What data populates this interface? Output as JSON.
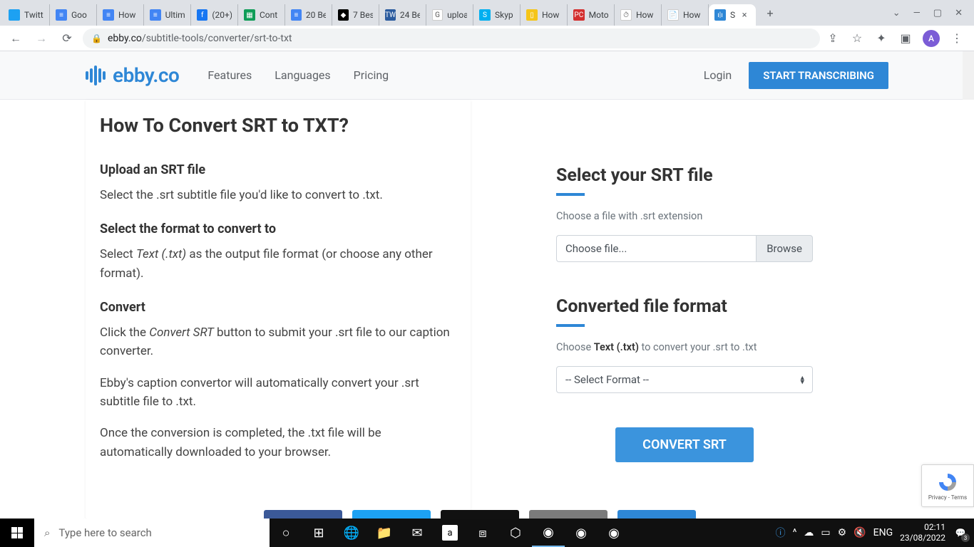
{
  "browser": {
    "tabs": [
      {
        "label": "Twitt",
        "icon_color": "#1da1f2",
        "icon_text": ""
      },
      {
        "label": "Goo",
        "icon_color": "#4285f4",
        "icon_text": "≡"
      },
      {
        "label": "How",
        "icon_color": "#4285f4",
        "icon_text": "≡"
      },
      {
        "label": "Ultim",
        "icon_color": "#4285f4",
        "icon_text": "≡"
      },
      {
        "label": "(20+)",
        "icon_color": "#1877f2",
        "icon_text": "f"
      },
      {
        "label": "Cont",
        "icon_color": "#0f9d58",
        "icon_text": "▦"
      },
      {
        "label": "20 Be",
        "icon_color": "#4285f4",
        "icon_text": "≡"
      },
      {
        "label": "7 Bes",
        "icon_color": "#000",
        "icon_text": "◆"
      },
      {
        "label": "24 Be",
        "icon_color": "#2b5b9e",
        "icon_text": "TW"
      },
      {
        "label": "uploa",
        "icon_color": "#fff",
        "icon_text": "G"
      },
      {
        "label": "Skyp",
        "icon_color": "#00aff0",
        "icon_text": "S"
      },
      {
        "label": "How",
        "icon_color": "#f5c518",
        "icon_text": "▯"
      },
      {
        "label": "Moto",
        "icon_color": "#d32f2f",
        "icon_text": "PC"
      },
      {
        "label": "How",
        "icon_color": "#fff",
        "icon_text": "⏱"
      },
      {
        "label": "How",
        "icon_color": "#fff",
        "icon_text": "📄"
      },
      {
        "label": "S",
        "icon_color": "#2e87d6",
        "icon_text": "ı|ı",
        "active": true
      }
    ],
    "url_domain": "ebby.co",
    "url_path": "/subtitle-tools/converter/srt-to-txt",
    "profile_letter": "A"
  },
  "header": {
    "brand": "ebby.co",
    "nav": [
      "Features",
      "Languages",
      "Pricing"
    ],
    "login": "Login",
    "cta": "START TRANSCRIBING"
  },
  "left": {
    "title": "How To Convert SRT to TXT?",
    "s1_h": "Upload an SRT file",
    "s1_p": "Select the .srt subtitle file you'd like to convert to .txt.",
    "s2_h": "Select the format to convert to",
    "s2_p_a": "Select ",
    "s2_p_em": "Text (.txt)",
    "s2_p_b": " as the output file format (or choose any other format).",
    "s3_h": "Convert",
    "s3_p1_a": "Click the ",
    "s3_p1_em": "Convert SRT",
    "s3_p1_b": " button to submit your .srt file to our caption converter.",
    "s3_p2": "Ebby's caption convertor will automatically convert your .srt subtitle file to .txt.",
    "s3_p3": "Once the conversion is completed, the .txt file will be automatically downloaded to your browser."
  },
  "right": {
    "title1": "Select your SRT file",
    "hint1": "Choose a file with .srt extension",
    "file_placeholder": "Choose file...",
    "browse": "Browse",
    "title2": "Converted file format",
    "hint2_a": "Choose ",
    "hint2_strong": "Text (.txt)",
    "hint2_b": " to convert your .srt to .txt",
    "select_placeholder": "-- Select Format --",
    "convert": "CONVERT SRT"
  },
  "recaptcha": {
    "line1": "Privacy",
    "line2": "Terms"
  },
  "social_colors": [
    "#3b5998",
    "#1da1f2",
    "#111",
    "#7b7b7b",
    "#2e87d6"
  ],
  "taskbar": {
    "search_placeholder": "Type here to search",
    "lang": "ENG",
    "time": "02:11",
    "date": "23/08/2022",
    "notif_count": "3"
  }
}
